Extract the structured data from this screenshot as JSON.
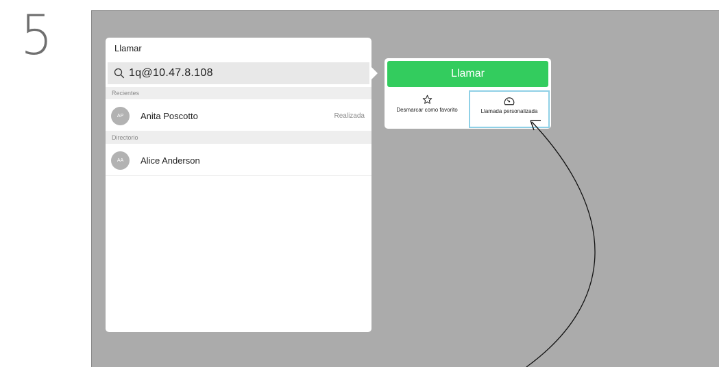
{
  "step": {
    "number": "5"
  },
  "call_panel": {
    "title": "Llamar",
    "search": {
      "value": "1q@10.47.8.108"
    },
    "sections": {
      "recent_label": "Recientes",
      "directory_label": "Directorio"
    },
    "recent": [
      {
        "initials": "AP",
        "name": "Anita Poscotto",
        "status": "Realizada"
      }
    ],
    "directory": [
      {
        "initials": "AA",
        "name": "Alice Anderson"
      }
    ]
  },
  "actions": {
    "call_label": "Llamar",
    "unfavorite_label": "Desmarcar como favorito",
    "custom_call_label": "Llamada personalizada"
  },
  "colors": {
    "call_green": "#33cc5e",
    "screen_gray": "#ababab",
    "highlight_blue": "#8fd0e6"
  },
  "icons": {
    "search": "search-icon",
    "star": "star-icon",
    "custom_call": "gauge-icon"
  }
}
